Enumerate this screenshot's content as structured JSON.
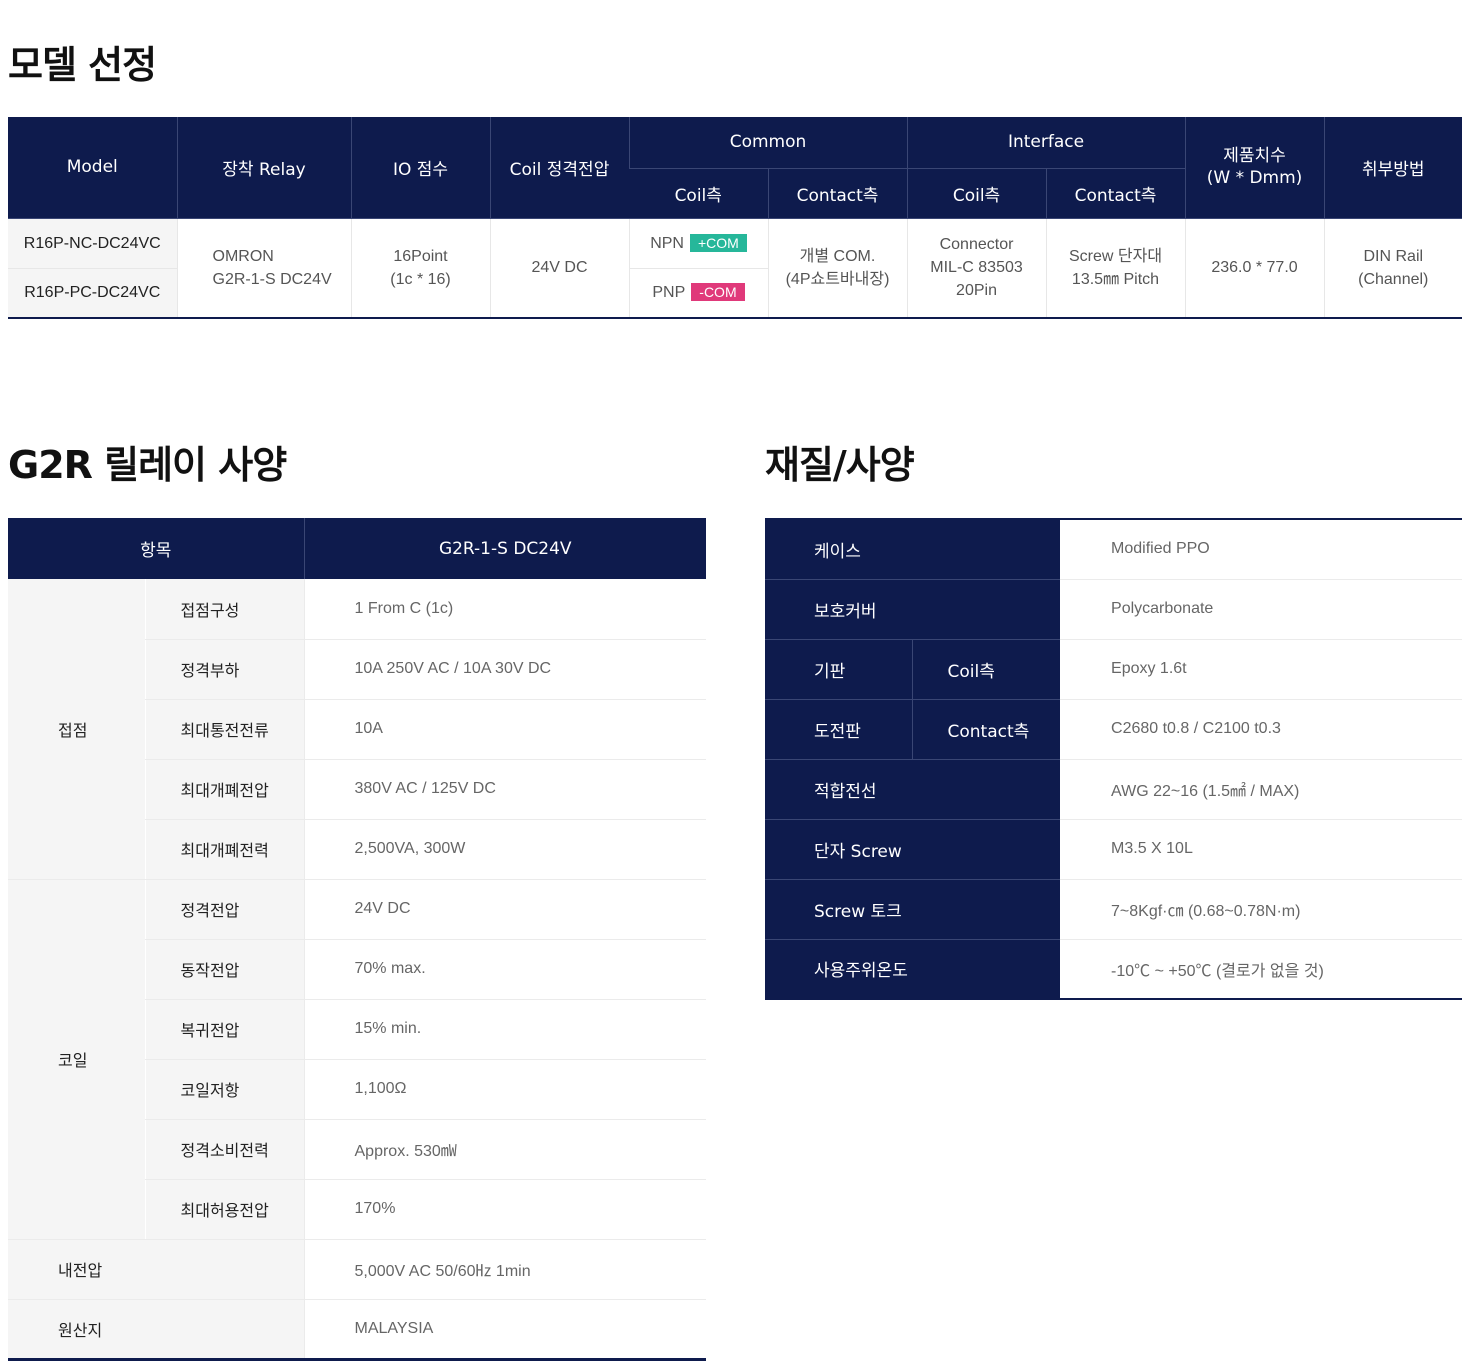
{
  "model_section": {
    "title": "모델 선정",
    "headers": {
      "model": "Model",
      "relay": "장착 Relay",
      "io": "IO 점수",
      "coil_voltage": "Coil 정격전압",
      "common": "Common",
      "interface": "Interface",
      "common_coil": "Coil측",
      "common_contact": "Contact측",
      "interface_coil": "Coil측",
      "interface_contact": "Contact측",
      "dimension": "제품치수\n(W * Dmm)",
      "mounting": "취부방법"
    },
    "row": {
      "models": [
        "R16P-NC-DC24VC",
        "R16P-PC-DC24VC"
      ],
      "relay": "OMRON\nG2R-1-S DC24V",
      "io": "16Point\n(1c * 16)",
      "coil_voltage": "24V DC",
      "common_coil": [
        {
          "type": "NPN",
          "tag": "+COM"
        },
        {
          "type": "PNP",
          "tag": "-COM"
        }
      ],
      "common_contact": "개별 COM.\n(4P쇼트바내장)",
      "interface_coil": "Connector\nMIL-C 83503\n20Pin",
      "interface_contact": "Screw 단자대\n13.5㎜ Pitch",
      "dimension": "236.0 * 77.0",
      "mounting": "DIN Rail\n(Channel)"
    },
    "colors": {
      "header_bg": "#0e1b4d",
      "npn_tag": "#26b79a",
      "pnp_tag": "#e0397a"
    }
  },
  "relay_section": {
    "title": "G2R 릴레이 사양",
    "header_item": "항목",
    "header_value": "G2R-1-S DC24V",
    "groups": [
      {
        "name": "접점",
        "rows": [
          {
            "label": "접점구성",
            "value": "1 From C (1c)"
          },
          {
            "label": "정격부하",
            "value": "10A 250V AC / 10A 30V DC"
          },
          {
            "label": "최대통전전류",
            "value": "10A"
          },
          {
            "label": "최대개폐전압",
            "value": "380V AC / 125V DC"
          },
          {
            "label": "최대개폐전력",
            "value": "2,500VA, 300W"
          }
        ]
      },
      {
        "name": "코일",
        "rows": [
          {
            "label": "정격전압",
            "value": "24V DC"
          },
          {
            "label": "동작전압",
            "value": "70% max."
          },
          {
            "label": "복귀전압",
            "value": "15% min."
          },
          {
            "label": "코일저항",
            "value": "1,100Ω"
          },
          {
            "label": "정격소비전력",
            "value": "Approx. 530㎽"
          },
          {
            "label": "최대허용전압",
            "value": "170%"
          }
        ]
      }
    ],
    "singles": [
      {
        "label": "내전압",
        "value": "5,000V AC 50/60㎐ 1min"
      },
      {
        "label": "원산지",
        "value": "MALAYSIA"
      }
    ]
  },
  "material_section": {
    "title": "재질/사양",
    "rows": [
      {
        "label": "케이스",
        "value": "Modified PPO"
      },
      {
        "label": "보호커버",
        "value": "Polycarbonate"
      },
      {
        "label": "기판",
        "sub": "Coil측",
        "value": "Epoxy 1.6t"
      },
      {
        "label": "도전판",
        "sub": "Contact측",
        "value": "C2680 t0.8 / C2100 t0.3"
      },
      {
        "label": "적합전선",
        "value": "AWG 22~16 (1.5㎟ / MAX)"
      },
      {
        "label": "단자 Screw",
        "value": "M3.5 X 10L"
      },
      {
        "label": "Screw 토크",
        "value": "7~8Kgf·㎝ (0.68~0.78N·m)"
      },
      {
        "label": "사용주위온도",
        "value": "-10℃ ~ +50℃ (결로가 없을 것)"
      }
    ]
  }
}
